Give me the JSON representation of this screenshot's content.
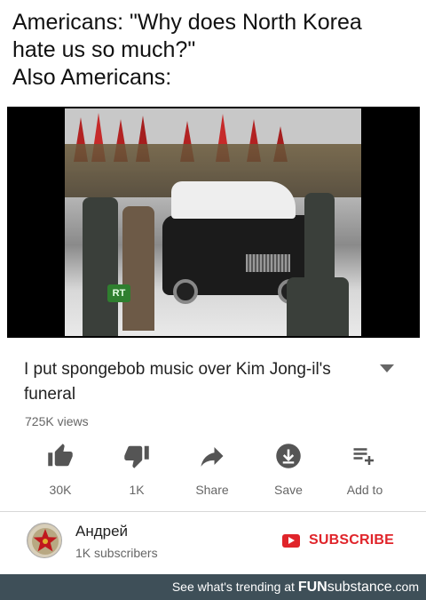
{
  "caption": {
    "line1": "Americans: \"Why does North Korea",
    "line2": "hate us so much?\"",
    "line3": "Also Americans:"
  },
  "video": {
    "watermark": "RT",
    "title": "I put spongebob music over Kim Jong-il's funeral",
    "views": "725K views"
  },
  "actions": [
    {
      "icon": "thumbs-up-icon",
      "label": "30K"
    },
    {
      "icon": "thumbs-down-icon",
      "label": "1K"
    },
    {
      "icon": "share-icon",
      "label": "Share"
    },
    {
      "icon": "save-icon",
      "label": "Save"
    },
    {
      "icon": "add-to-playlist-icon",
      "label": "Add to"
    }
  ],
  "channel": {
    "name": "Андрей",
    "subscribers": "1K subscribers",
    "subscribe_label": "SUBSCRIBE"
  },
  "footer": {
    "text": "See what's trending at ",
    "brand_main": "FUN",
    "brand_sub": "substance",
    "brand_tld": ".com"
  },
  "colors": {
    "subscribe_red": "#e0242a",
    "footer_bg": "#3e4f58"
  }
}
